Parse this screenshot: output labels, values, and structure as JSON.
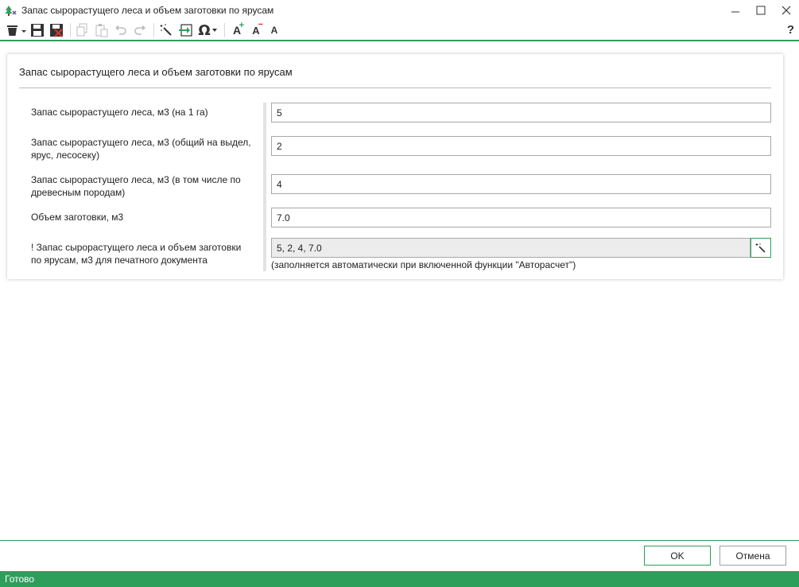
{
  "window": {
    "title": "Запас сырорастущего леса и объем заготовки по ярусам",
    "help": "?"
  },
  "toolbar": {
    "icons": [
      "trash-dropdown-icon",
      "save-icon",
      "save-close-icon",
      "copy-icon",
      "paste-icon",
      "undo-icon",
      "redo-icon",
      "magic-wand-icon",
      "insert-icon",
      "omega-icon",
      "font-increase-icon",
      "font-decrease-icon",
      "font-default-icon"
    ],
    "omega": "Ω",
    "font_a": "A"
  },
  "form": {
    "title": "Запас сырорастущего леса и объем заготовки по ярусам",
    "fields": [
      {
        "label": "Запас сырорастущего леса, м3 (на 1 га)",
        "value": "5"
      },
      {
        "label": "Запас сырорастущего леса, м3 (общий на выдел, ярус, лесосеку)",
        "value": "2"
      },
      {
        "label": "Запас сырорастущего леса, м3 (в том числе по древесным породам)",
        "value": "4"
      },
      {
        "label": "Объем заготовки, м3",
        "value": "7.0"
      },
      {
        "label": "! Запас сырорастущего леса и объем заготовки по ярусам, м3 для печатного документа",
        "value": "5, 2, 4, 7.0"
      }
    ],
    "hint": "(заполняется автоматически при включенной функции \"Авторасчет\")"
  },
  "footer": {
    "ok": "OK",
    "cancel": "Отмена"
  },
  "status": {
    "text": "Готово"
  },
  "colors": {
    "accent": "#2e9e5b"
  }
}
